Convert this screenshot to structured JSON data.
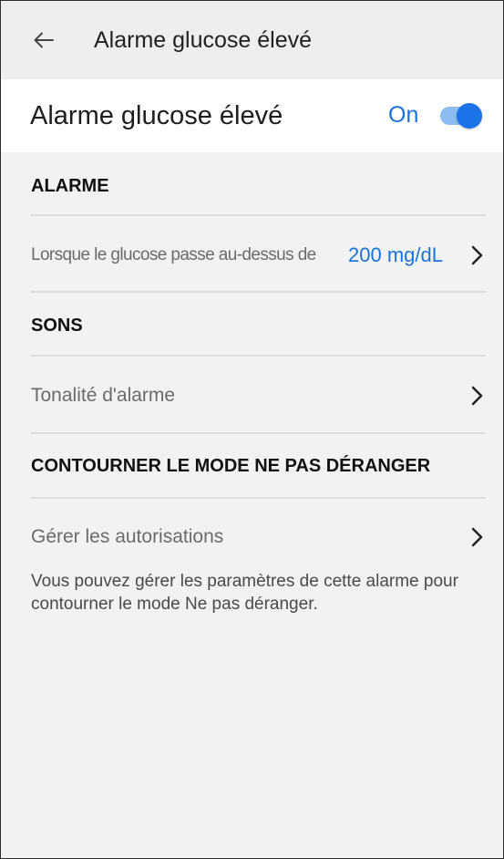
{
  "header": {
    "title": "Alarme glucose élevé"
  },
  "alarm_toggle": {
    "title": "Alarme glucose élevé",
    "state_label": "On",
    "enabled": true
  },
  "sections": {
    "alarm": {
      "title": "ALARME",
      "threshold_label": "Lorsque le glucose passe au-dessus de",
      "threshold_value": "200 mg/dL"
    },
    "sounds": {
      "title": "SONS",
      "tone_label": "Tonalité d'alarme"
    },
    "dnd": {
      "title": "CONTOURNER LE MODE NE PAS DÉRANGER",
      "manage_label": "Gérer les autorisations",
      "description": "Vous pouvez gérer les paramètres de cette alarme pour contourner le mode Ne pas déranger."
    }
  },
  "colors": {
    "accent": "#1a73d9",
    "background": "#f2f2f2",
    "header_bg": "#eeeeee"
  },
  "icons": {
    "back": "arrow-left-icon",
    "chevron": "chevron-right-icon"
  }
}
